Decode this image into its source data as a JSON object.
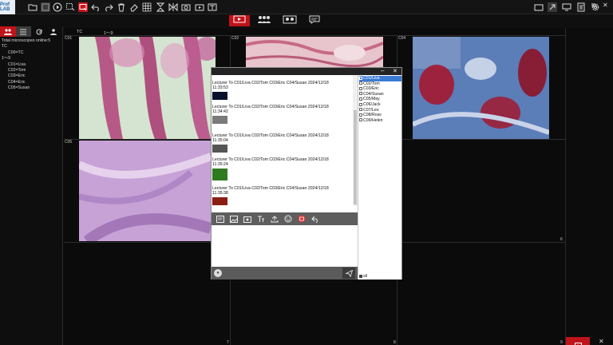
{
  "app": {
    "logo_text": "Prof LAB"
  },
  "toolbar": {
    "icons": [
      "folder-icon",
      "save-icon",
      "play-icon",
      "select-icon",
      "record-icon",
      "undo-icon",
      "redo-icon",
      "delete-icon",
      "eraser-icon",
      "grid-icon",
      "flip-icon",
      "mirror-icon",
      "snapshot-icon",
      "video-icon",
      "text-icon",
      "screen-icon"
    ]
  },
  "center_toolbar": {
    "buttons": [
      "broadcast-icon",
      "group-icon",
      "compare-icon",
      "chat-icon"
    ]
  },
  "left_panel": {
    "online_text": "Total microscopes online:5",
    "group_tc": "TC",
    "item_c00": "C00=TC",
    "range": "1～9",
    "students": [
      "C01=Liva",
      "C02=Tom",
      "C03=Eric",
      "C04=Eric",
      "C05=Susan"
    ]
  },
  "grid_header": {
    "tc": "TC",
    "range": "1～9"
  },
  "cells": {
    "c01": "C01",
    "c02": "C02",
    "c04": "C04",
    "c05": "C05",
    "n6": "6",
    "n7": "7",
    "n8": "8",
    "n9": "9"
  },
  "chat": {
    "messages": [
      {
        "text": "Lecturer To C01/Liva C02/Tom C03/Eric C04/Susan  2024/12/18",
        "time": "11:33:53"
      },
      {
        "text": "Lecturer To C01/Liva C02/Tom C03/Eric C04/Susan  2024/12/18",
        "time": "11:34:42"
      },
      {
        "text": "Lecturer To C01/Liva C02/Tom C03/Eric C04/Susan  2024/12/18",
        "time": "11:35:04"
      },
      {
        "text": "Lecturer To C01/Liva C02/Tom C03/Eric C04/Susan  2024/12/18",
        "time": "11:35:24"
      },
      {
        "text": "Lecturer To C01/Liva C02/Tom C03/Eric C04/Susan  2024/12/18",
        "time": "11:35:38"
      }
    ],
    "users": [
      "C01/Liva",
      "C02/Tom",
      "C03/Eric",
      "C04/Susan",
      "C05/May",
      "C06/Jack",
      "C07/Leo",
      "C08/Ross",
      "C09/Helen"
    ],
    "all_label": "all",
    "minimize": "–",
    "close": "✕"
  },
  "window": {
    "min": "–",
    "max": "⧉",
    "close": "✕"
  },
  "colors": {
    "accent": "#c0131a",
    "bg": "#0b0b0b",
    "selection": "#3a7bd5"
  }
}
